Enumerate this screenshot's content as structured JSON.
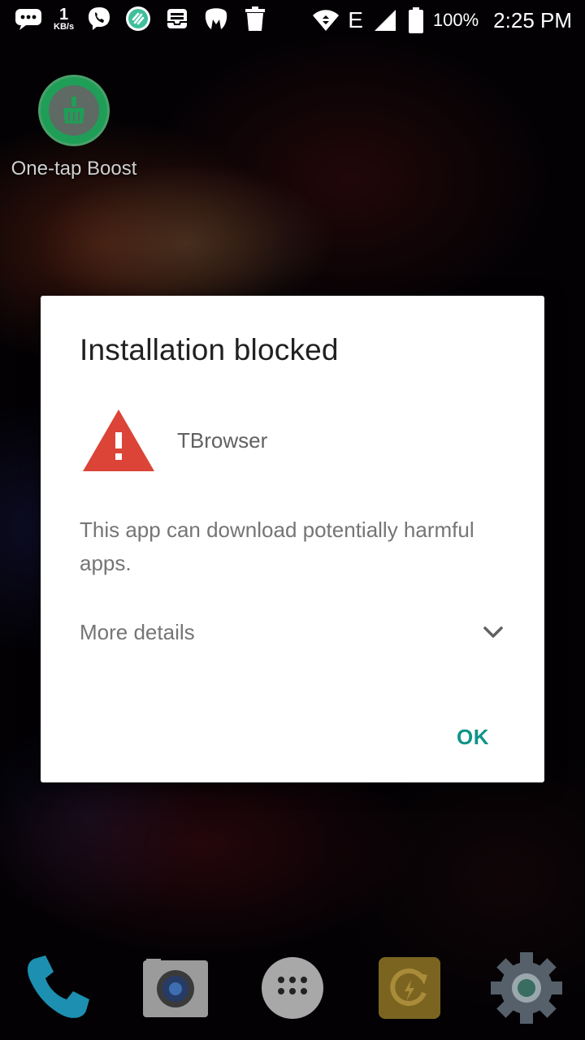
{
  "status_bar": {
    "net_speed_value": "1",
    "net_speed_unit": "KB/s",
    "battery_percent": "100%",
    "network_type": "E",
    "time": "2:25 PM"
  },
  "desktop": {
    "shortcut_label": "One-tap Boost"
  },
  "dialog": {
    "title": "Installation blocked",
    "app_name": "TBrowser",
    "message": "This app can download potentially harmful apps.",
    "more_details_label": "More details",
    "ok_label": "OK"
  },
  "dock": {
    "items": [
      "phone-icon",
      "camera-icon",
      "app-drawer-icon",
      "boost-icon",
      "settings-icon"
    ]
  },
  "colors": {
    "accent": "#0f9488",
    "warning": "#db4437",
    "dialog_bg": "#ffffff",
    "title_text": "#212121",
    "body_text": "#757575"
  }
}
